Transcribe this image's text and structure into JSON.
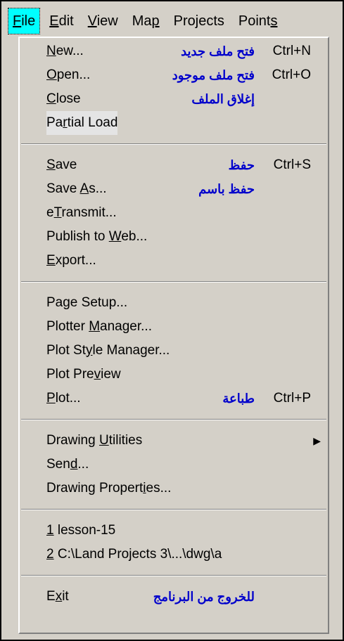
{
  "menubar": {
    "items": [
      {
        "pre": "",
        "u": "F",
        "post": "ile",
        "active": true
      },
      {
        "pre": "",
        "u": "E",
        "post": "dit"
      },
      {
        "pre": "",
        "u": "V",
        "post": "iew"
      },
      {
        "pre": "Ma",
        "u": "p",
        "post": ""
      },
      {
        "pre": "Projects",
        "u": "",
        "post": ""
      },
      {
        "pre": "Point",
        "u": "s",
        "post": ""
      }
    ]
  },
  "file_menu": {
    "items": [
      {
        "id": "new",
        "pre": "",
        "u": "N",
        "post": "ew...",
        "arabic": "فتح ملف جديد",
        "shortcut": "Ctrl+N"
      },
      {
        "id": "open",
        "pre": "",
        "u": "O",
        "post": "pen...",
        "arabic": "فتح ملف موجود",
        "shortcut": "Ctrl+O"
      },
      {
        "id": "close",
        "pre": "",
        "u": "C",
        "post": "lose",
        "arabic": "إغلاق الملف",
        "shortcut": ""
      },
      {
        "id": "partial-load",
        "pre": "Pa",
        "u": "r",
        "post": "tial Load",
        "arabic": "",
        "shortcut": ""
      },
      {
        "id": "save",
        "pre": "",
        "u": "S",
        "post": "ave",
        "arabic": "حفظ",
        "shortcut": "Ctrl+S"
      },
      {
        "id": "save-as",
        "pre": "Save ",
        "u": "A",
        "post": "s...",
        "arabic": "حفظ باسم",
        "shortcut": ""
      },
      {
        "id": "etransmit",
        "pre": "e",
        "u": "T",
        "post": "ransmit...",
        "arabic": "",
        "shortcut": ""
      },
      {
        "id": "publish-to-web",
        "pre": "Publish to ",
        "u": "W",
        "post": "eb...",
        "arabic": "",
        "shortcut": ""
      },
      {
        "id": "export",
        "pre": "",
        "u": "E",
        "post": "xport...",
        "arabic": "",
        "shortcut": ""
      },
      {
        "id": "page-setup",
        "pre": "Page Setup...",
        "u": "",
        "post": "",
        "arabic": "",
        "shortcut": ""
      },
      {
        "id": "plotter-manager",
        "pre": "Plotter ",
        "u": "M",
        "post": "anager...",
        "arabic": "",
        "shortcut": ""
      },
      {
        "id": "plot-style-manager",
        "pre": "Plot St",
        "u": "y",
        "post": "le Manager...",
        "arabic": "",
        "shortcut": ""
      },
      {
        "id": "plot-preview",
        "pre": "Plot Pre",
        "u": "v",
        "post": "iew",
        "arabic": "",
        "shortcut": ""
      },
      {
        "id": "plot",
        "pre": "",
        "u": "P",
        "post": "lot...",
        "arabic": "طباعة",
        "shortcut": "Ctrl+P"
      },
      {
        "id": "drawing-utilities",
        "pre": "Drawing ",
        "u": "U",
        "post": "tilities",
        "arabic": "",
        "shortcut": "",
        "submenu": "▶"
      },
      {
        "id": "send",
        "pre": "Sen",
        "u": "d",
        "post": "...",
        "arabic": "",
        "shortcut": ""
      },
      {
        "id": "drawing-properties",
        "pre": "Drawing Propert",
        "u": "i",
        "post": "es...",
        "arabic": "",
        "shortcut": ""
      },
      {
        "id": "recent-1",
        "pre": "",
        "u": "1",
        "post": " lesson-15",
        "arabic": "",
        "shortcut": ""
      },
      {
        "id": "recent-2",
        "pre": "",
        "u": "2",
        "post": " C:\\Land Projects 3\\...\\dwg\\a",
        "arabic": "",
        "shortcut": ""
      },
      {
        "id": "exit",
        "pre": "E",
        "u": "x",
        "post": "it",
        "arabic": "للخروج من البرنامج",
        "shortcut": ""
      }
    ]
  }
}
